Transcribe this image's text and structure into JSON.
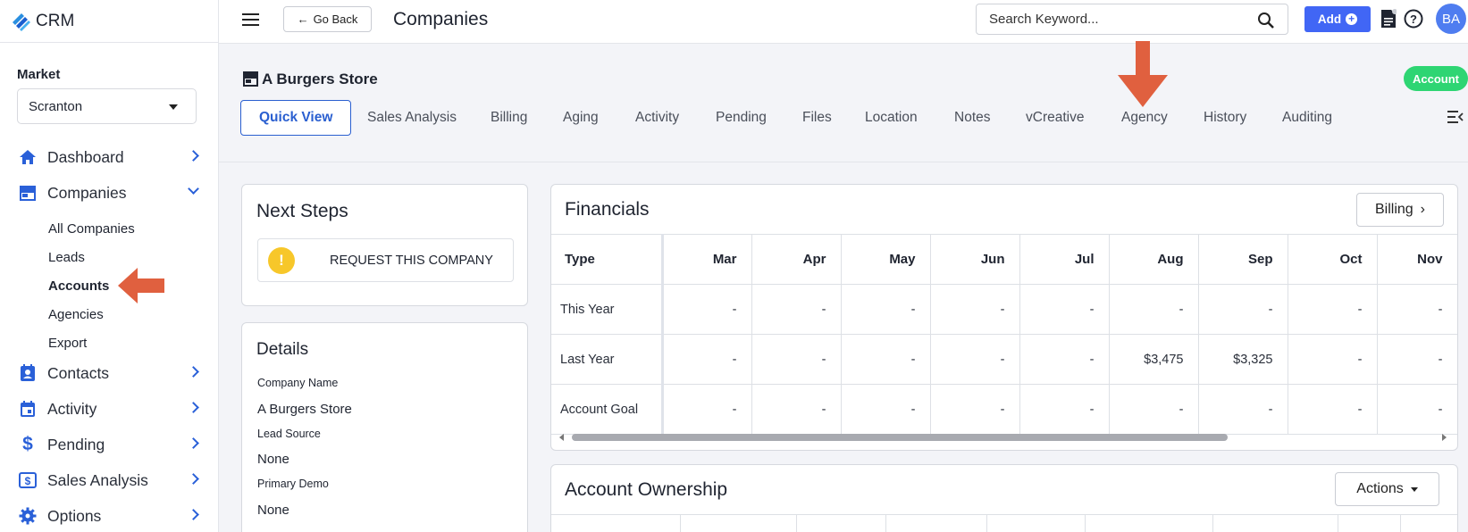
{
  "app": {
    "name": "CRM"
  },
  "sidebar": {
    "market_label": "Market",
    "market_value": "Scranton",
    "nav": [
      {
        "label": "Dashboard",
        "icon": "home-icon"
      },
      {
        "label": "Companies",
        "icon": "store-icon"
      },
      {
        "label": "Contacts",
        "icon": "contact-card-icon"
      },
      {
        "label": "Activity",
        "icon": "calendar-icon"
      },
      {
        "label": "Pending",
        "icon": "dollar-icon"
      },
      {
        "label": "Sales Analysis",
        "icon": "dollar-box-icon"
      },
      {
        "label": "Options",
        "icon": "gear-icon"
      }
    ],
    "companies_sub": [
      "All Companies",
      "Leads",
      "Accounts",
      "Agencies",
      "Export"
    ],
    "active_sub": "Accounts"
  },
  "topbar": {
    "back_label": "Go Back",
    "page_title": "Companies",
    "search_placeholder": "Search Keyword...",
    "add_label": "Add",
    "avatar_initials": "BA"
  },
  "company": {
    "name": "A Burgers Store",
    "badge": "Account",
    "tabs": [
      "Quick View",
      "Sales Analysis",
      "Billing",
      "Aging",
      "Activity",
      "Pending",
      "Files",
      "Location",
      "Notes",
      "vCreative",
      "Agency",
      "History",
      "Auditing"
    ],
    "active_tab": "Quick View"
  },
  "next_steps": {
    "title": "Next Steps",
    "request_label": "REQUEST THIS COMPANY"
  },
  "details": {
    "title": "Details",
    "fields": [
      {
        "label": "Company Name",
        "value": "A Burgers Store"
      },
      {
        "label": "Lead Source",
        "value": "None"
      },
      {
        "label": "Primary Demo",
        "value": "None"
      }
    ]
  },
  "financials": {
    "title": "Financials",
    "billing_button": "Billing",
    "columns": [
      "Type",
      "Mar",
      "Apr",
      "May",
      "Jun",
      "Jul",
      "Aug",
      "Sep",
      "Oct",
      "Nov"
    ],
    "rows": [
      {
        "type": "This Year",
        "values": [
          "-",
          "-",
          "-",
          "-",
          "-",
          "-",
          "-",
          "-",
          "-"
        ]
      },
      {
        "type": "Last Year",
        "values": [
          "-",
          "-",
          "-",
          "-",
          "-",
          "$3,475",
          "$3,325",
          "-",
          "-"
        ]
      },
      {
        "type": "Account Goal",
        "values": [
          "-",
          "-",
          "-",
          "-",
          "-",
          "-",
          "-",
          "-",
          "-"
        ]
      }
    ]
  },
  "ownership": {
    "title": "Account Ownership",
    "actions_button": "Actions"
  },
  "colors": {
    "primary": "#4166f5",
    "nav_icon": "#2a60d8",
    "badge": "#2ed573",
    "annotation_arrow": "#e0603f",
    "warning": "#f7c72a"
  }
}
